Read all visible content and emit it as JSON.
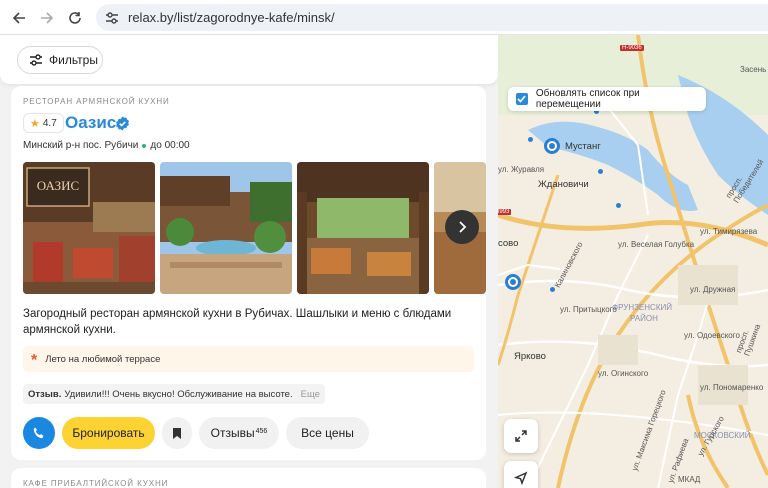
{
  "browser": {
    "url": "relax.by/list/zagorodnye-kafe/minsk/",
    "back_icon": "arrow-left-icon",
    "forward_icon": "arrow-right-icon",
    "reload_icon": "reload-icon",
    "site_settings_icon": "tune-icon"
  },
  "filters": {
    "label": "Фильтры",
    "icon": "sliders-icon"
  },
  "listing": {
    "category": "РЕСТОРАН АРМЯНСКОЙ КУХНИ",
    "rating": "4.7",
    "name": "Оазис",
    "address": "Минский р-н пос. Рубичи",
    "hours": "до 00:00",
    "description": "Загородный ресторан армянской кухни в Рубичах. Шашлыки и меню с блюдами армянской кухни.",
    "feature": "Лето на любимой террасе",
    "review_label": "Отзыв.",
    "review_text": "Удивили!!! Очень вкусно! Обслуживание на высоте.",
    "review_more": "Еще",
    "book_label": "Бронировать",
    "reviews_label": "Отзывы",
    "reviews_count": "456",
    "prices_label": "Все цены",
    "photo_sign": "ОАЗИС"
  },
  "next_listing": {
    "category": "КАФЕ ПРИБАЛТИЙСКОЙ КУХНИ"
  },
  "map": {
    "update_label": "Обновлять список при перемещении",
    "update_checked": true,
    "labels": {
      "mustang": "Мустанг",
      "zhdanovichi": "Ждановичи",
      "sovo": "совo",
      "frunzensky": "ФРУНЗЕНСКИЙ",
      "rayon": "РАЙОН",
      "moskovsky": "МОСКОВСКИЙ",
      "yarkovo": "Ярково",
      "zasen": "Засень",
      "mkad": "МКАД",
      "zhuravlya": "ул. Журавля",
      "n9036": "Н-9036",
      "r8993": "8993",
      "pobediteley": "просп. Победителей",
      "timiryazeva": "ул. Тимирязева",
      "golubka": "ул. Веселая Голубка",
      "kalinovskogo": "Калиновского",
      "pritytskogo": "ул. Притыцкого",
      "odoevskogo": "ул. Одоевского",
      "oginskogo": "ул. Огинского",
      "ponomarenko": "ул. Пономаренко",
      "gurskogo": "ул. Гурского",
      "goretskogo": "ул. Максима Горецкого",
      "rafieva": "ул. Рафиева",
      "pushkina": "просп. Пушкина",
      "druzhnaya": "ул. Дружная"
    }
  }
}
